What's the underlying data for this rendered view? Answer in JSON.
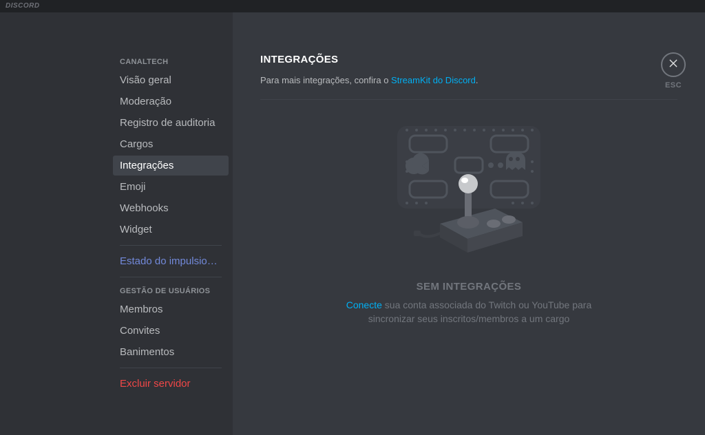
{
  "app": {
    "wordmark": "DISCORD"
  },
  "close": {
    "label": "ESC"
  },
  "sidebar": {
    "section_server": {
      "header": "CANALTECH",
      "items": [
        {
          "label": "Visão geral",
          "name": "sidebar-item-overview"
        },
        {
          "label": "Moderação",
          "name": "sidebar-item-moderation"
        },
        {
          "label": "Registro de auditoria",
          "name": "sidebar-item-audit-log"
        },
        {
          "label": "Cargos",
          "name": "sidebar-item-roles"
        },
        {
          "label": "Integrações",
          "name": "sidebar-item-integrations",
          "active": true
        },
        {
          "label": "Emoji",
          "name": "sidebar-item-emoji"
        },
        {
          "label": "Webhooks",
          "name": "sidebar-item-webhooks"
        },
        {
          "label": "Widget",
          "name": "sidebar-item-widget"
        }
      ],
      "boost": {
        "label": "Estado do impulsionam..."
      }
    },
    "section_users": {
      "header": "GESTÃO DE USUÁRIOS",
      "items": [
        {
          "label": "Membros",
          "name": "sidebar-item-members"
        },
        {
          "label": "Convites",
          "name": "sidebar-item-invites"
        },
        {
          "label": "Banimentos",
          "name": "sidebar-item-bans"
        }
      ]
    },
    "delete": {
      "label": "Excluir servidor"
    }
  },
  "main": {
    "title": "INTEGRAÇÕES",
    "sub_prefix": "Para mais integrações, confira o ",
    "sub_link": "StreamKit do Discord",
    "sub_suffix": ".",
    "empty": {
      "title": "SEM INTEGRAÇÕES",
      "link": "Conecte",
      "rest": " sua conta associada do Twitch ou YouTube para sincronizar seus inscritos/membros a um cargo"
    }
  }
}
